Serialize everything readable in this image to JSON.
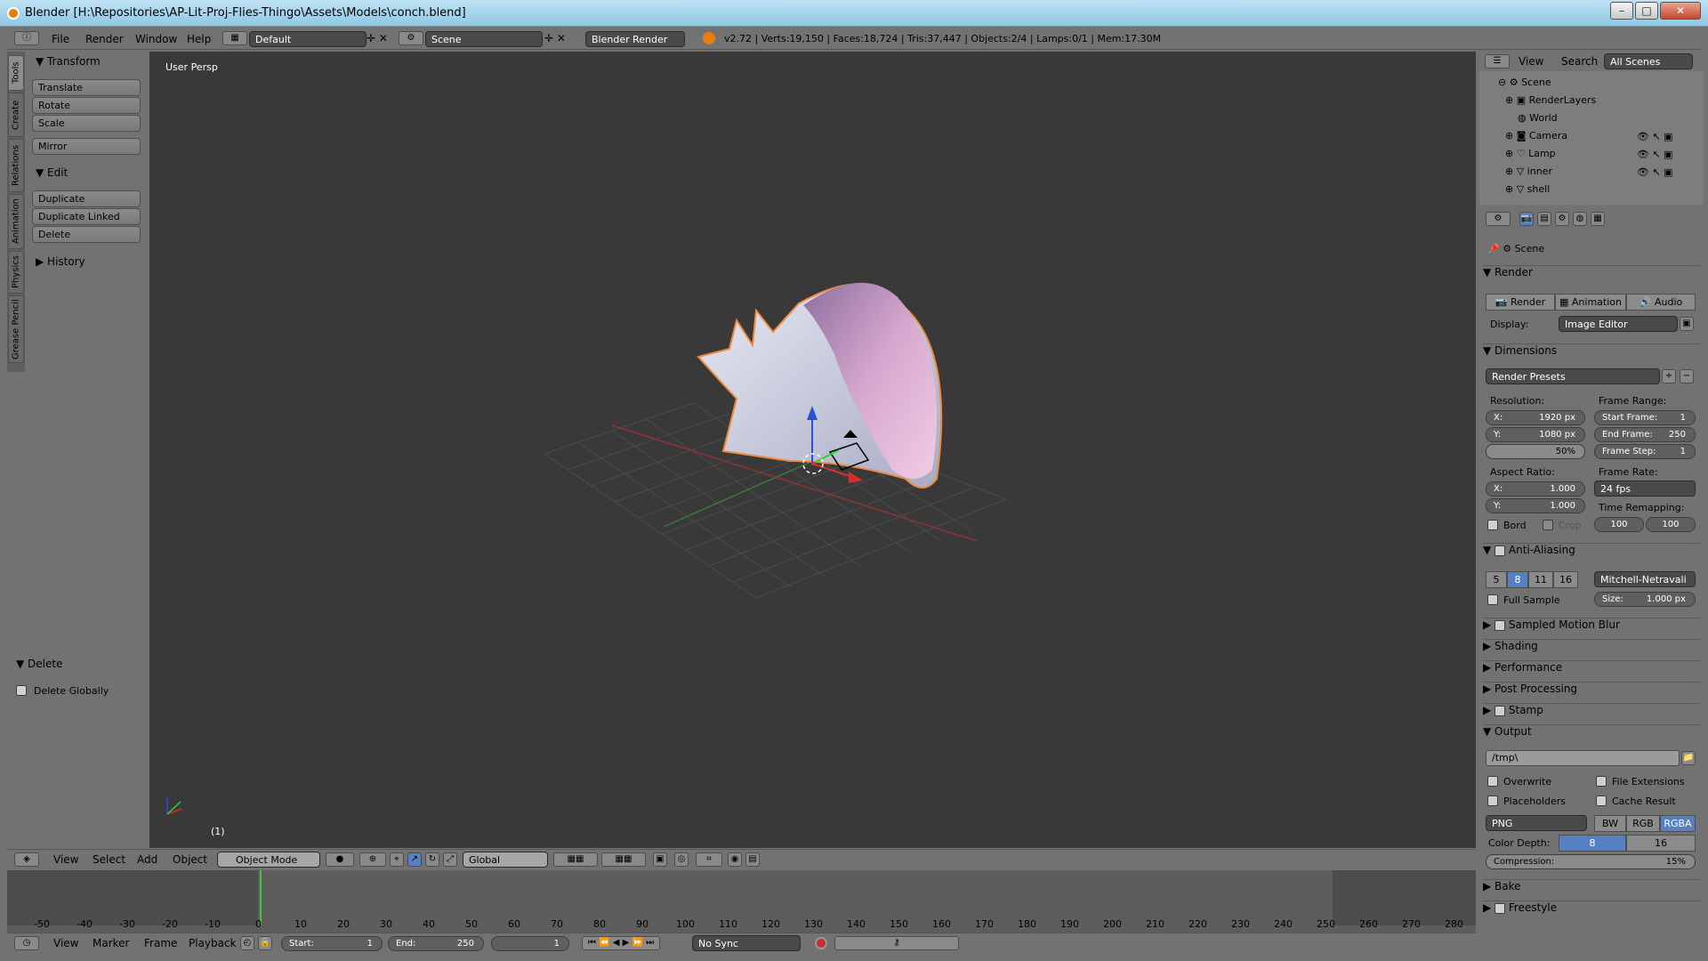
{
  "title": "Blender [H:\\Repositories\\AP-Lit-Proj-Flies-Thingo\\Assets\\Models\\conch.blend]",
  "menus": [
    "File",
    "Render",
    "Window",
    "Help"
  ],
  "screen_layout": "Default",
  "scene": "Scene",
  "engine": "Blender Render",
  "stats": "v2.72 | Verts:19,150 | Faces:18,724 | Tris:37,447 | Objects:2/4 | Lamps:0/1 | Mem:17.30M",
  "tool_tabs": [
    "Tools",
    "Create",
    "Relations",
    "Animation",
    "Physics",
    "Grease Pencil"
  ],
  "transform": {
    "header": "Transform",
    "buttons": [
      "Translate",
      "Rotate",
      "Scale"
    ],
    "mirror": "Mirror"
  },
  "edit": {
    "header": "Edit",
    "buttons": [
      "Duplicate",
      "Duplicate Linked",
      "Delete"
    ]
  },
  "history": "History",
  "delete_panel": {
    "header": "Delete",
    "option": "Delete Globally"
  },
  "viewport": {
    "label": "User Persp",
    "frame": "(1)"
  },
  "view3d_header": {
    "menus": [
      "View",
      "Select",
      "Add",
      "Object"
    ],
    "mode": "Object Mode",
    "orientation": "Global"
  },
  "timeline": {
    "ticks": [
      "-50",
      "-40",
      "-30",
      "-20",
      "-10",
      "0",
      "10",
      "20",
      "30",
      "40",
      "50",
      "60",
      "70",
      "80",
      "90",
      "100",
      "110",
      "120",
      "130",
      "140",
      "150",
      "160",
      "170",
      "180",
      "190",
      "200",
      "210",
      "220",
      "230",
      "240",
      "250",
      "260",
      "270",
      "280"
    ],
    "menus": [
      "View",
      "Marker",
      "Frame",
      "Playback"
    ],
    "start_label": "Start:",
    "start": "1",
    "end_label": "End:",
    "end": "250",
    "current": "1",
    "sync": "No Sync"
  },
  "outliner": {
    "menus": [
      "View",
      "Search"
    ],
    "filter": "All Scenes",
    "rows": [
      "Scene",
      "RenderLayers",
      "World",
      "Camera",
      "Lamp",
      "inner",
      "shell"
    ]
  },
  "props": {
    "context": "Scene",
    "render_section": "Render",
    "render_buttons": [
      "Render",
      "Animation",
      "Audio"
    ],
    "display_label": "Display:",
    "display": "Image Editor",
    "dimensions": "Dimensions",
    "presets": "Render Presets",
    "resolution_label": "Resolution:",
    "res_x": "1920 px",
    "res_y": "1080 px",
    "res_pct": "50%",
    "frame_range_label": "Frame Range:",
    "start_frame": "1",
    "end_frame": "250",
    "frame_step": "1",
    "start_frame_label": "Start Frame:",
    "end_frame_label": "End Frame:",
    "frame_step_label": "Frame Step:",
    "aspect_label": "Aspect Ratio:",
    "aspect_x": "1.000",
    "aspect_y": "1.000",
    "frame_rate_label": "Frame Rate:",
    "fps": "24 fps",
    "time_remap_label": "Time Remapping:",
    "remap_old": "100",
    "remap_new": "100",
    "bord": "Bord",
    "crop": "Crop",
    "aa": "Anti-Aliasing",
    "aa_samples": [
      "5",
      "8",
      "11",
      "16"
    ],
    "aa_filter": "Mitchell-Netravali",
    "full_sample": "Full Sample",
    "size_label": "Size:",
    "size": "1.000 px",
    "collapsed": [
      "Sampled Motion Blur",
      "Shading",
      "Performance",
      "Post Processing",
      "Stamp"
    ],
    "output": "Output",
    "path": "/tmp\\",
    "overwrite": "Overwrite",
    "file_ext": "File Extensions",
    "placeholders": "Placeholders",
    "cache": "Cache Result",
    "format": "PNG",
    "color_modes": [
      "BW",
      "RGB",
      "RGBA"
    ],
    "color_depth_label": "Color Depth:",
    "depths": [
      "8",
      "16"
    ],
    "compression_label": "Compression:",
    "compression": "15%",
    "bottom": [
      "Bake",
      "Freestyle"
    ]
  },
  "colors": {
    "accent": "#5680c2",
    "selection_outline": "#e5843a"
  }
}
